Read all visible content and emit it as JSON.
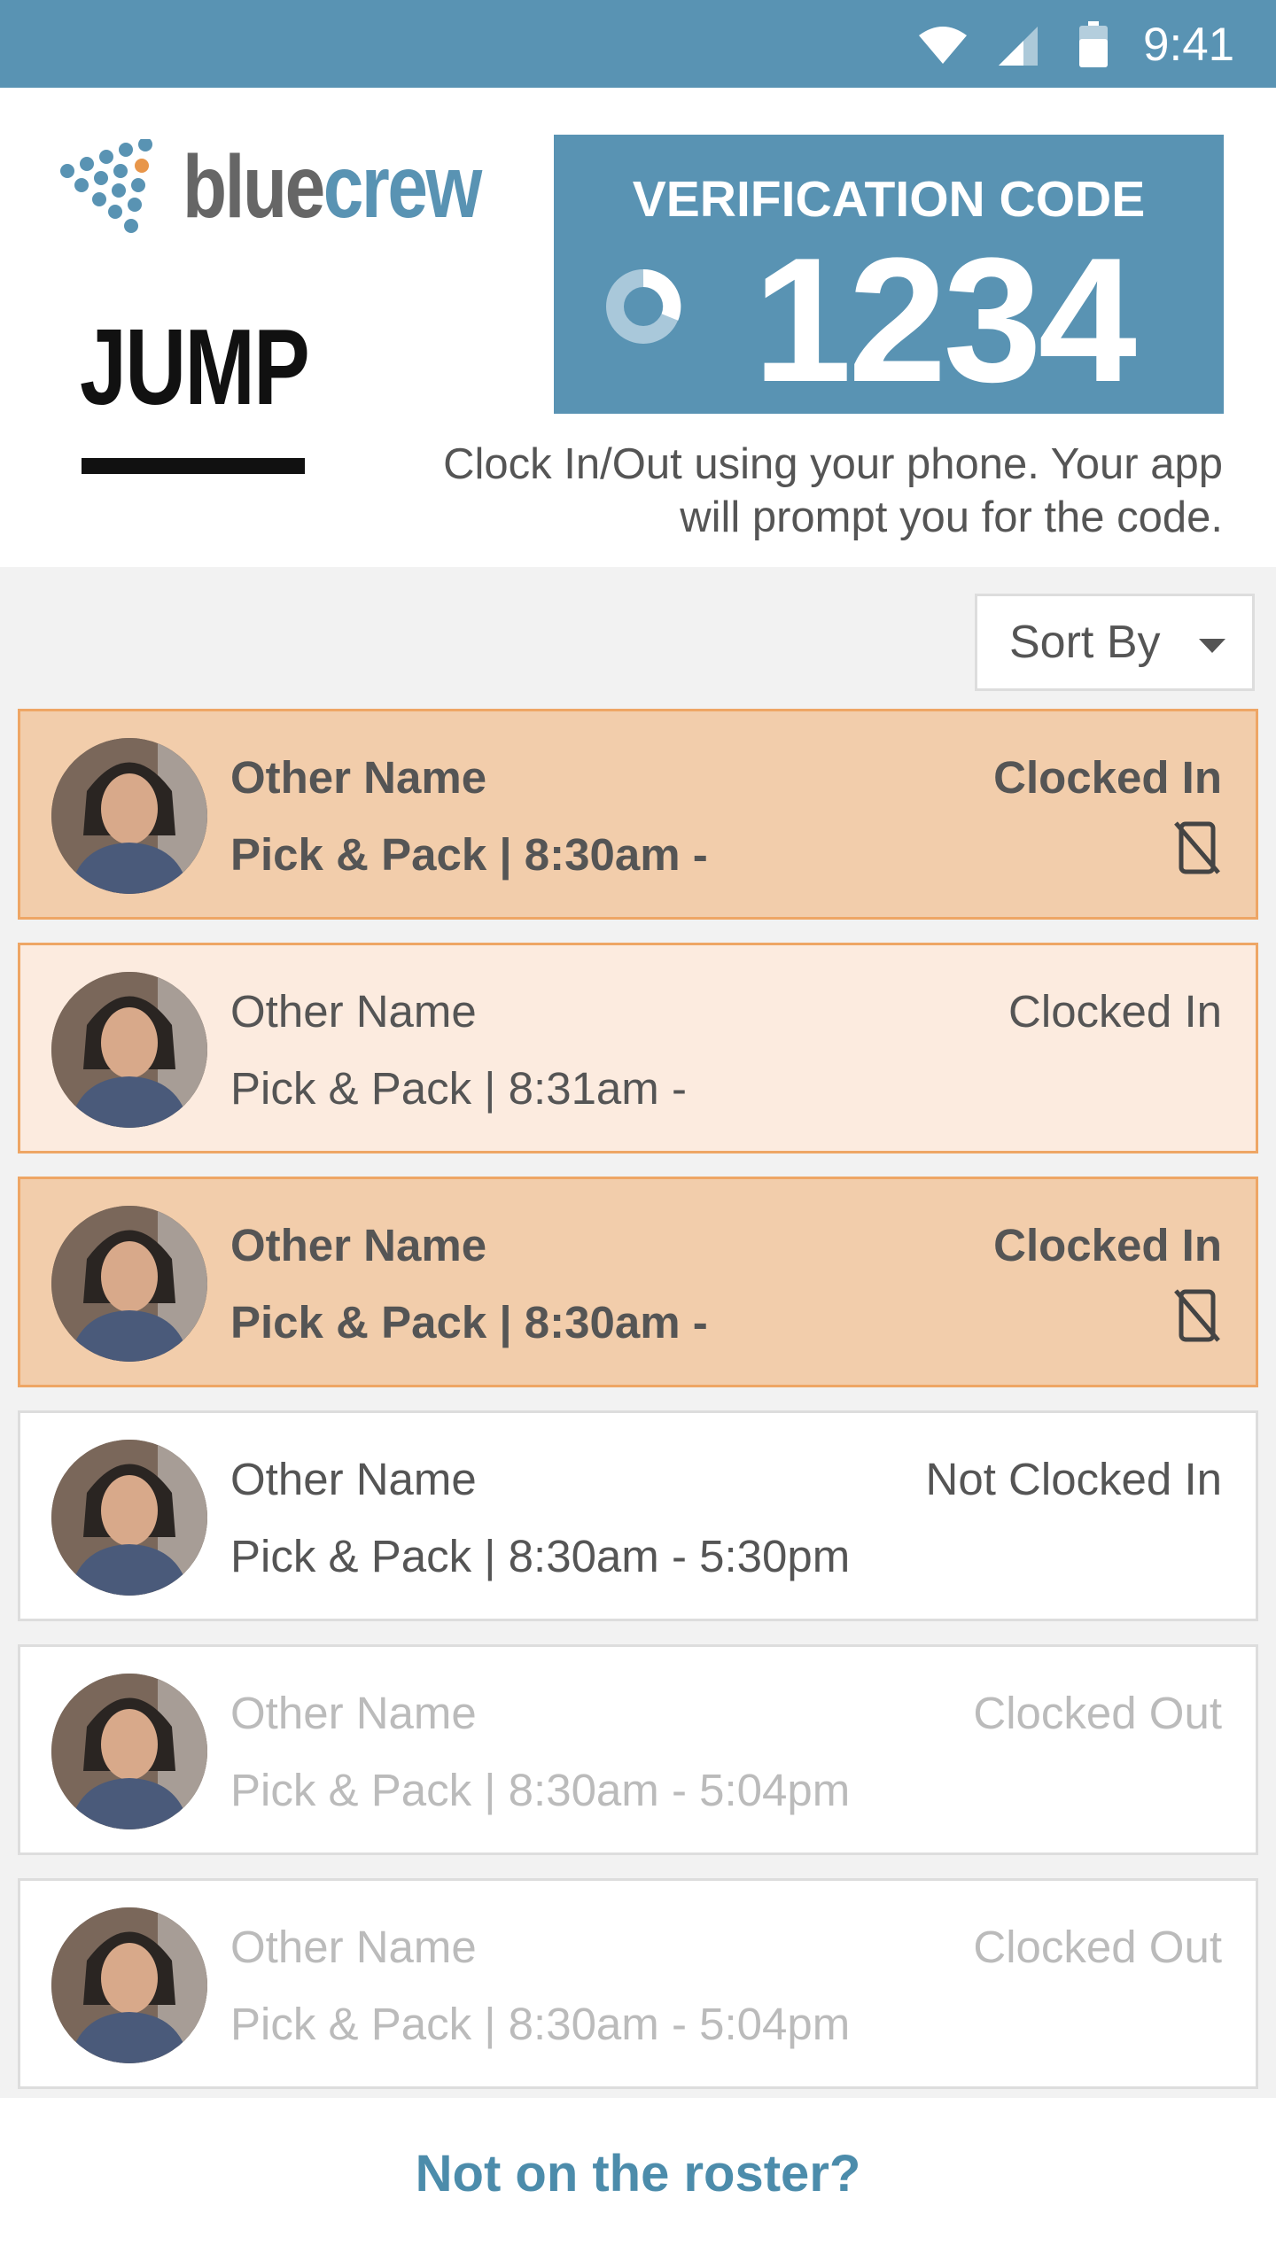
{
  "status_bar": {
    "time": "9:41"
  },
  "brand": {
    "logo_blue": "blue",
    "logo_crew": "crew",
    "client_name": "JUMP"
  },
  "verification": {
    "label": "VERIFICATION CODE",
    "code": "1234",
    "instructions": "Clock In/Out using your phone. Your app will prompt you for the code."
  },
  "sort": {
    "label": "Sort By"
  },
  "roster": [
    {
      "name": "Other Name",
      "shift": "Pick & Pack | 8:30am -",
      "status": "Clocked In",
      "icon": "phone-off-icon"
    },
    {
      "name": "Other Name",
      "shift": "Pick & Pack | 8:31am -",
      "status": "Clocked In"
    },
    {
      "name": "Other Name",
      "shift": "Pick & Pack | 8:30am -",
      "status": "Clocked In",
      "icon": "phone-off-icon"
    },
    {
      "name": "Other Name",
      "shift": "Pick & Pack | 8:30am - 5:30pm",
      "status": "Not Clocked In"
    },
    {
      "name": "Other Name",
      "shift": "Pick & Pack | 8:30am - 5:04pm",
      "status": "Clocked Out"
    },
    {
      "name": "Other Name",
      "shift": "Pick & Pack | 8:30am - 5:04pm",
      "status": "Clocked Out"
    }
  ],
  "footer": {
    "link": "Not on the roster?"
  },
  "colors": {
    "brand_blue": "#5993b3",
    "highlight_strong": "#f2cdab",
    "highlight_light": "#fcebdf",
    "highlight_border": "#eea665",
    "link": "#4c8cab"
  }
}
